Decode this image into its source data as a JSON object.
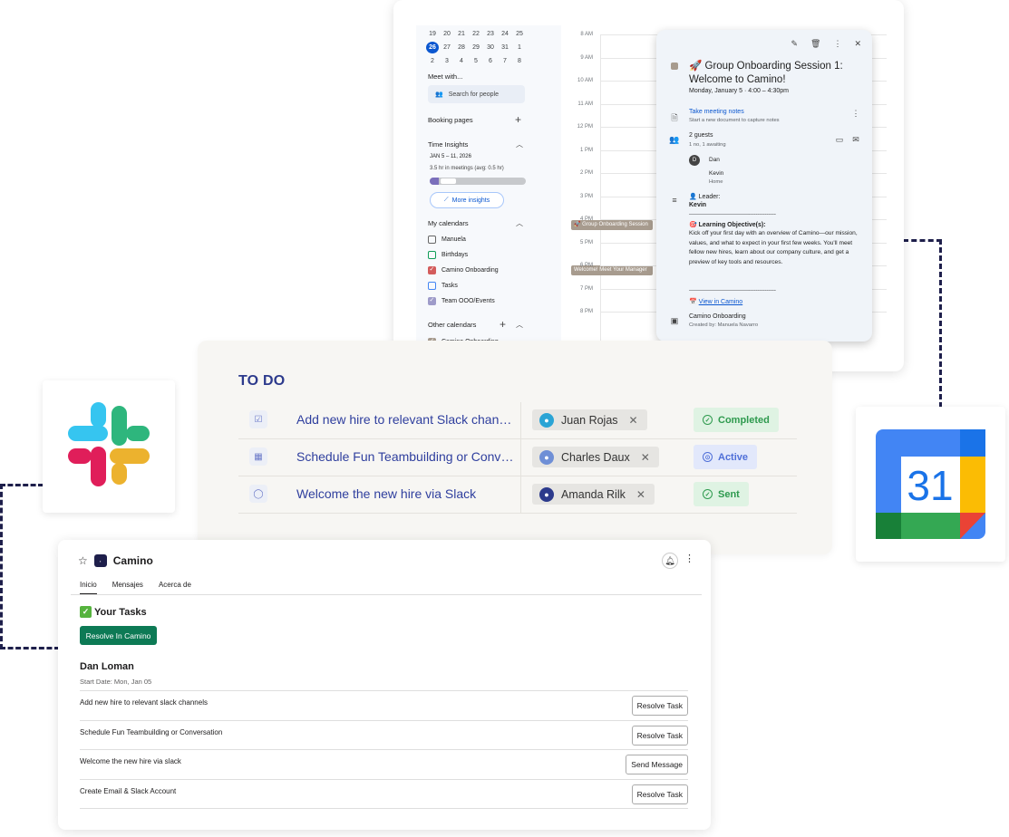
{
  "calendar": {
    "mini_rows": [
      [
        "19",
        "20",
        "21",
        "22",
        "23",
        "24",
        "25"
      ],
      [
        "26",
        "27",
        "28",
        "29",
        "30",
        "31",
        "1"
      ],
      [
        "2",
        "3",
        "4",
        "5",
        "6",
        "7",
        "8"
      ]
    ],
    "today": "26",
    "meet_with": "Meet with...",
    "search_people": "Search for people",
    "booking_pages": "Booking pages",
    "time_insights": "Time Insights",
    "insights_range": "JAN 5 – 11, 2026",
    "insights_stat": "3.5 hr in meetings (avg: 0.5 hr)",
    "more_insights": "More insights",
    "my_calendars_label": "My calendars",
    "my_calendars": [
      {
        "label": "Manuela",
        "checked": false,
        "color": "#666666"
      },
      {
        "label": "Birthdays",
        "checked": false,
        "color": "#0f9d58"
      },
      {
        "label": "Camino Onboarding",
        "checked": true,
        "color": "#d35c5c"
      },
      {
        "label": "Tasks",
        "checked": false,
        "color": "#4285f4"
      },
      {
        "label": "Team OOO/Events",
        "checked": true,
        "color": "#9e9bc9"
      }
    ],
    "other_calendars_label": "Other calendars",
    "other_calendars": [
      {
        "label": "Camino Onboarding",
        "checked": true,
        "color": "#a79b8e"
      }
    ],
    "hours": [
      "8 AM",
      "9 AM",
      "10 AM",
      "11 AM",
      "12 PM",
      "1 PM",
      "2 PM",
      "3 PM",
      "4 PM",
      "5 PM",
      "6 PM",
      "7 PM",
      "8 PM"
    ],
    "events": [
      "🚀 Group Onboarding Session",
      "Welcome! Meet Your Manager"
    ],
    "popup": {
      "title": "🚀 Group Onboarding Session 1: Welcome to Camino!",
      "when": "Monday, January 5  ·  4:00 – 4:30pm",
      "notes_link": "Take meeting notes",
      "notes_sub": "Start a new document to capture notes",
      "guests_count": "2 guests",
      "guests_sub": "1 no, 1 awaiting",
      "guests": [
        {
          "initial": "D",
          "name": "Dan",
          "sub": ""
        },
        {
          "initial": "",
          "name": "Kevin",
          "sub": "Home"
        }
      ],
      "leader_label": "👤 Leader:",
      "leader_name": "Kevin",
      "divider": "------------------------------------------------",
      "objective_label": "🎯 Learning Objective(s):",
      "objective_text": "Kick off your first day with an overview of Camino—our mission, values, and what to expect in your first few weeks. You'll meet fellow new hires, learn about our company culture, and get a preview of key tools and resources.",
      "view_link": "View in Camino",
      "calendar_name": "Camino Onboarding",
      "created_by": "Created by: Manuela Navarro"
    }
  },
  "todo": {
    "title": "TO DO",
    "rows": [
      {
        "icon": "☑",
        "task": "Add new hire to relevant Slack channels",
        "assignee": "Juan Rojas",
        "avatar_color": "#2aa4d5",
        "status": "Completed",
        "status_color": "#2e9a4e",
        "status_bg": "#dff3e3"
      },
      {
        "icon": "▦",
        "task": "Schedule Fun Teambuilding or Conversation",
        "assignee": "Charles Daux",
        "avatar_color": "#6f8fd6",
        "status": "Active",
        "status_color": "#4f6fd8",
        "status_bg": "#e2e8fb"
      },
      {
        "icon": "◯",
        "task": "Welcome the new hire via Slack",
        "assignee": "Amanda Rilk",
        "avatar_color": "#2c3a8c",
        "status": "Sent",
        "status_color": "#2e9a4e",
        "status_bg": "#dff3e3"
      }
    ]
  },
  "gcal_logo": {
    "number": "31"
  },
  "camino_app": {
    "name": "Camino",
    "tabs": [
      "Inicio",
      "Mensajes",
      "Acerca de"
    ],
    "active_tab": "Inicio",
    "your_tasks": "Your Tasks",
    "resolve_in_camino": "Resolve In Camino",
    "employee": "Dan Loman",
    "start_date": "Start Date: Mon, Jan 05",
    "tasks": [
      {
        "label": "Add new hire to relevant slack channels",
        "action": "Resolve Task"
      },
      {
        "label": "Schedule Fun Teambuilding or Conversation",
        "action": "Resolve Task"
      },
      {
        "label": "Welcome the new hire via slack",
        "action": "Send Message"
      },
      {
        "label": "Create Email & Slack Account",
        "action": "Resolve Task"
      }
    ]
  }
}
